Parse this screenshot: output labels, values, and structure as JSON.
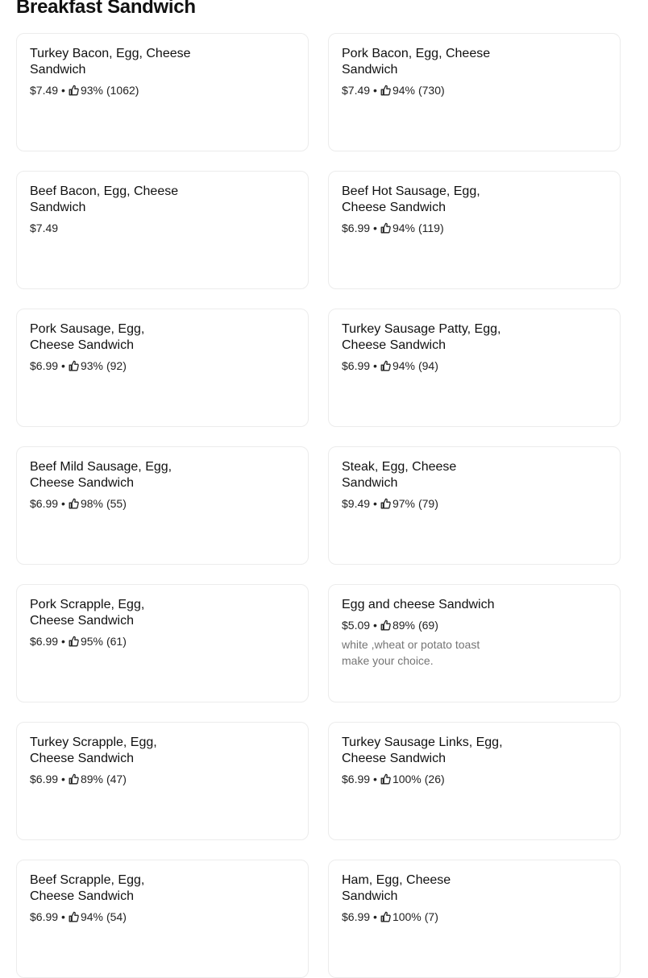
{
  "section": {
    "title": "Breakfast Sandwich"
  },
  "items": [
    {
      "name": "Turkey Bacon, Egg, Cheese Sandwich",
      "price": "$7.49",
      "rating": "93%",
      "count": "(1062)",
      "description": ""
    },
    {
      "name": "Pork Bacon, Egg, Cheese Sandwich",
      "price": "$7.49",
      "rating": "94%",
      "count": "(730)",
      "description": ""
    },
    {
      "name": "Beef Bacon, Egg, Cheese Sandwich",
      "price": "$7.49",
      "rating": "",
      "count": "",
      "description": ""
    },
    {
      "name": "Beef Hot Sausage, Egg, Cheese Sandwich",
      "price": "$6.99",
      "rating": "94%",
      "count": "(119)",
      "description": ""
    },
    {
      "name": "Pork Sausage, Egg, Cheese Sandwich",
      "price": "$6.99",
      "rating": "93%",
      "count": "(92)",
      "description": ""
    },
    {
      "name": "Turkey Sausage Patty, Egg, Cheese Sandwich",
      "price": "$6.99",
      "rating": "94%",
      "count": "(94)",
      "description": ""
    },
    {
      "name": "Beef Mild Sausage, Egg, Cheese Sandwich",
      "price": "$6.99",
      "rating": "98%",
      "count": "(55)",
      "description": ""
    },
    {
      "name": "Steak, Egg, Cheese Sandwich",
      "price": "$9.49",
      "rating": "97%",
      "count": "(79)",
      "description": ""
    },
    {
      "name": "Pork Scrapple, Egg, Cheese Sandwich",
      "price": "$6.99",
      "rating": "95%",
      "count": "(61)",
      "description": ""
    },
    {
      "name": "Egg and cheese Sandwich",
      "price": "$5.09",
      "rating": "89%",
      "count": "(69)",
      "description": "white ,wheat or potato toast make your choice."
    },
    {
      "name": "Turkey Scrapple, Egg, Cheese Sandwich",
      "price": "$6.99",
      "rating": "89%",
      "count": "(47)",
      "description": ""
    },
    {
      "name": "Turkey Sausage Links, Egg, Cheese Sandwich",
      "price": "$6.99",
      "rating": "100%",
      "count": "(26)",
      "description": ""
    },
    {
      "name": "Beef Scrapple, Egg, Cheese Sandwich",
      "price": "$6.99",
      "rating": "94%",
      "count": "(54)",
      "description": ""
    },
    {
      "name": "Ham, Egg, Cheese Sandwich",
      "price": "$6.99",
      "rating": "100%",
      "count": "(7)",
      "description": ""
    }
  ],
  "separator": "•",
  "icons": {
    "rating": "thumbs-up-icon"
  }
}
